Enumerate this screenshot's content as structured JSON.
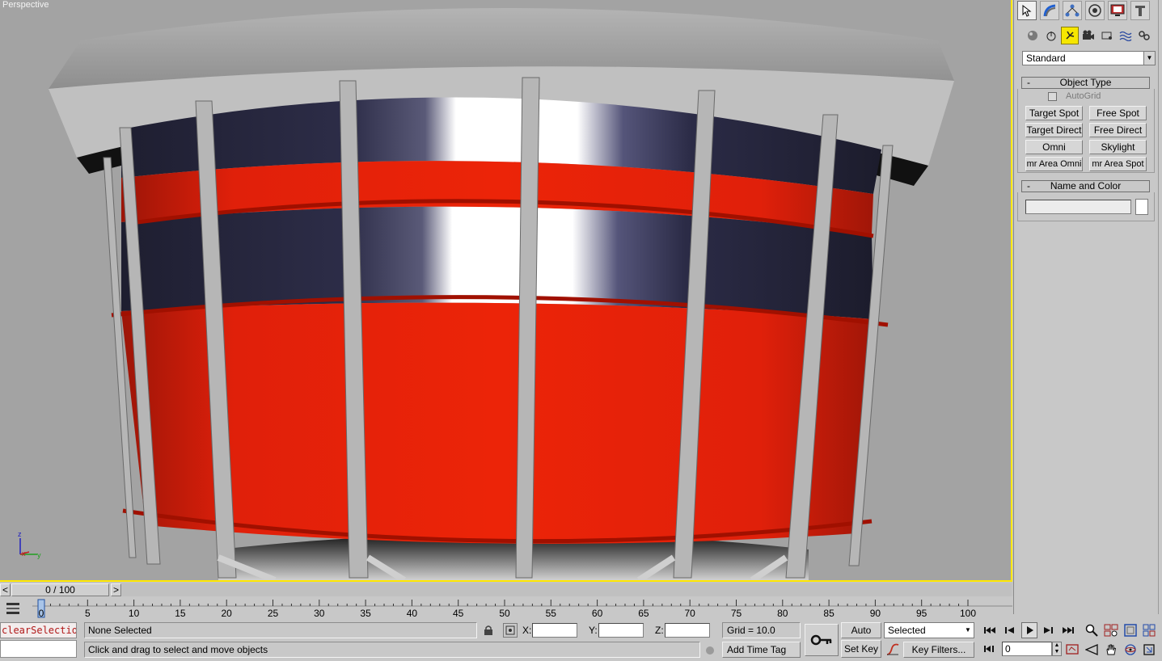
{
  "viewport": {
    "label": "Perspective",
    "axis": {
      "z": "z",
      "x": "x",
      "y": "y"
    }
  },
  "command_panel": {
    "tabs": [
      "select-arrow-icon",
      "create-icon",
      "modify-icon",
      "hierarchy-icon",
      "motion-icon",
      "display-icon",
      "utilities-icon"
    ],
    "category_dropdown": "Standard",
    "object_type": {
      "title": "Object Type",
      "minus": "-",
      "autogrid": "AutoGrid",
      "buttons": [
        "Target Spot",
        "Free Spot",
        "Target Direct",
        "Free Direct",
        "Omni",
        "Skylight",
        "mr Area Omni",
        "mr Area Spot"
      ]
    },
    "name_color": {
      "title": "Name and Color",
      "minus": "-",
      "name_value": "",
      "swatch_color": "#ffffff"
    }
  },
  "timeline": {
    "slider_label": "0 / 100",
    "prev": "<",
    "next": ">",
    "ticks": [
      "0",
      "5",
      "10",
      "15",
      "20",
      "25",
      "30",
      "35",
      "40",
      "45",
      "50",
      "55",
      "60",
      "65",
      "70",
      "75",
      "80",
      "85",
      "90",
      "95",
      "100"
    ]
  },
  "status": {
    "maxscript_text": "clearSelectio",
    "selection": "None Selected",
    "prompt": "Click and drag to select and move objects",
    "x_label": "X:",
    "y_label": "Y:",
    "z_label": "Z:",
    "grid": "Grid = 10.0",
    "add_time_tag": "Add Time Tag",
    "auto_key": "Auto Key",
    "set_key": "Set Key",
    "selected_dropdown": "Selected",
    "key_filters": "Key Filters...",
    "frame_value": "0"
  },
  "colors": {
    "viewport_bg": "#a3a3a3",
    "active_border": "#ffe800",
    "red": "#e8200a",
    "navy": "#2a2a45"
  }
}
